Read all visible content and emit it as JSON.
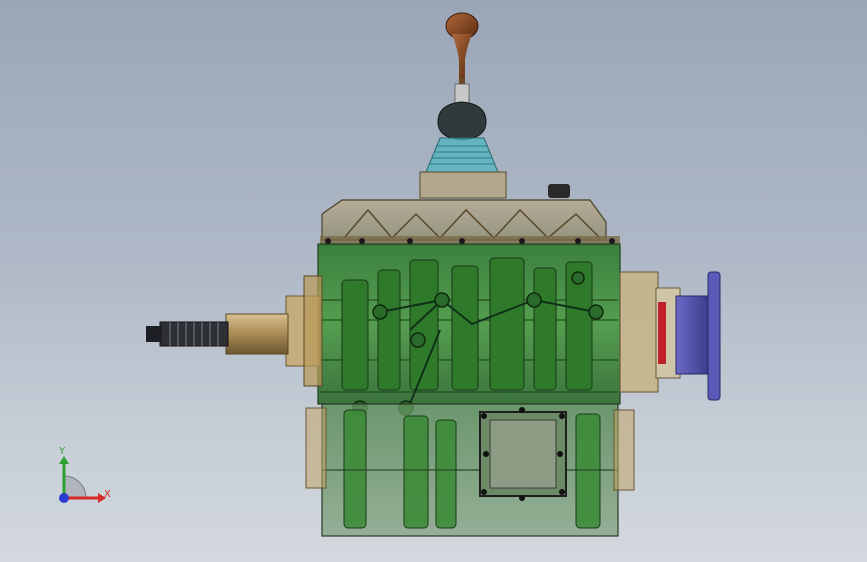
{
  "viewport": {
    "model": "gearbox-assembly",
    "display_mode": "transparent-shaded"
  },
  "triad": {
    "x_label": "X",
    "y_label": "Y",
    "x_color": "#d42a2a",
    "y_color": "#2aa12a",
    "z_color": "#2a3ad4"
  },
  "colors": {
    "housing_green": "#3f8a3a",
    "housing_dark": "#24512a",
    "brass": "#b8985e",
    "knob": "#8a4a22",
    "boot": "#2e3a3c",
    "cyan_part": "#4fb6c0",
    "flange_blue": "#4f4fa8",
    "flange_red": "#c0202a"
  }
}
